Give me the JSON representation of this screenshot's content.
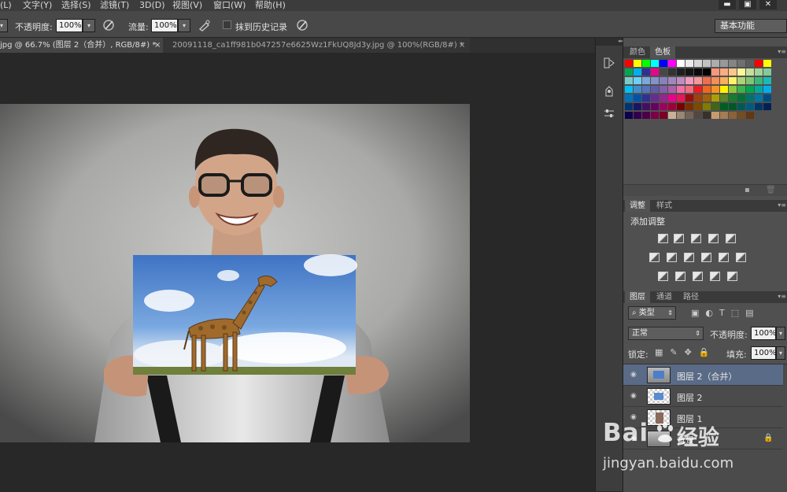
{
  "menu": [
    "(L)",
    "文字(Y)",
    "选择(S)",
    "滤镜(T)",
    "3D(D)",
    "视图(V)",
    "窗口(W)",
    "帮助(H)"
  ],
  "options": {
    "opacity_label": "不透明度:",
    "opacity_value": "100%",
    "flow_label": "流量:",
    "flow_value": "100%",
    "erase_history_label": "抹到历史记录",
    "workspace": "基本功能"
  },
  "tabs": [
    {
      "label": "jpg @ 66.7% (图层 2（合并）, RGB/8#) *",
      "close": "×",
      "active": true
    },
    {
      "label": "20091118_ca1ff981b047257e6625Wz1FkUQ8Jd3y.jpg @ 100%(RGB/8#) *",
      "close": "×",
      "active": false
    }
  ],
  "panels": {
    "swatch_tabs": [
      "颜色",
      "色板"
    ],
    "swatch_rows": [
      [
        "#ff0000",
        "#ffff00",
        "#00ff00",
        "#00ffff",
        "#0000ff",
        "#ff00ff",
        "#ffffff",
        "#ebebeb",
        "#d6d6d6",
        "#c2c2c2",
        "#adadad",
        "#999999",
        "#858585",
        "#707070",
        "#5c5c5c",
        "#ff0000",
        "#ffff00"
      ],
      [
        "#00a650",
        "#00aeef",
        "#2e3192",
        "#ec008c",
        "#474747",
        "#333333",
        "#1f1f1f",
        "#141414",
        "#0a0a0a",
        "#000000",
        "#f7977a",
        "#fbad82",
        "#fdc68c",
        "#fff799",
        "#c4df9b",
        "#a3d39c",
        "#82ca9c"
      ],
      [
        "#7accc8",
        "#6dcff6",
        "#7da7d9",
        "#8393ca",
        "#8781bd",
        "#a187be",
        "#bc8dbf",
        "#f49ac1",
        "#f5989d",
        "#f26c4f",
        "#f68e56",
        "#fbaf5d",
        "#fff467",
        "#acd373",
        "#7cc576",
        "#3bb878",
        "#1abbb4"
      ],
      [
        "#00bff3",
        "#438cca",
        "#5574b9",
        "#605ca8",
        "#855fa8",
        "#a763a9",
        "#f06ea9",
        "#f26d7d",
        "#ed1c24",
        "#f26522",
        "#f7941d",
        "#fff200",
        "#8dc63f",
        "#39b54a",
        "#00a651",
        "#00a99d",
        "#00aeef"
      ],
      [
        "#0072bc",
        "#0054a6",
        "#2e3192",
        "#662d91",
        "#92278f",
        "#ec008c",
        "#ed145b",
        "#9e0b0f",
        "#a0410d",
        "#a3620a",
        "#aba000",
        "#598527",
        "#197b30",
        "#007236",
        "#00746b",
        "#0076a3",
        "#004b80"
      ],
      [
        "#003471",
        "#1b1464",
        "#440e62",
        "#630460",
        "#9e005d",
        "#9e0039",
        "#790000",
        "#7b2e00",
        "#7d4900",
        "#827b00",
        "#406618",
        "#005e20",
        "#005826",
        "#005952",
        "#005b7f",
        "#003663",
        "#002157"
      ],
      [
        "#0d004c",
        "#32004b",
        "#4b0049",
        "#7b0046",
        "#7a0026",
        "#c7b299",
        "#998675",
        "#736357",
        "#534741",
        "#37302d",
        "#c69c6d",
        "#a67c52",
        "#8c6239",
        "#754c24",
        "#603913"
      ]
    ],
    "adjust_tabs": [
      "调整",
      "样式"
    ],
    "adjust_title": "添加调整",
    "layers_tabs": [
      "图层",
      "通道",
      "路径"
    ],
    "kind_label": "类型",
    "blend_mode": "正常",
    "opacity_label": "不透明度:",
    "opacity_value": "100%",
    "lock_label": "锁定:",
    "fill_label": "填充:",
    "fill_value": "100%",
    "layers": [
      {
        "name": "图层 2（合并）",
        "selected": true
      },
      {
        "name": "图层 2",
        "selected": false
      },
      {
        "name": "图层 1",
        "selected": false
      },
      {
        "name": "背景",
        "selected": false,
        "locked": true
      }
    ]
  },
  "watermark": {
    "brand": "Bai",
    "brand2": "经验",
    "url": "jingyan.baidu.com"
  }
}
